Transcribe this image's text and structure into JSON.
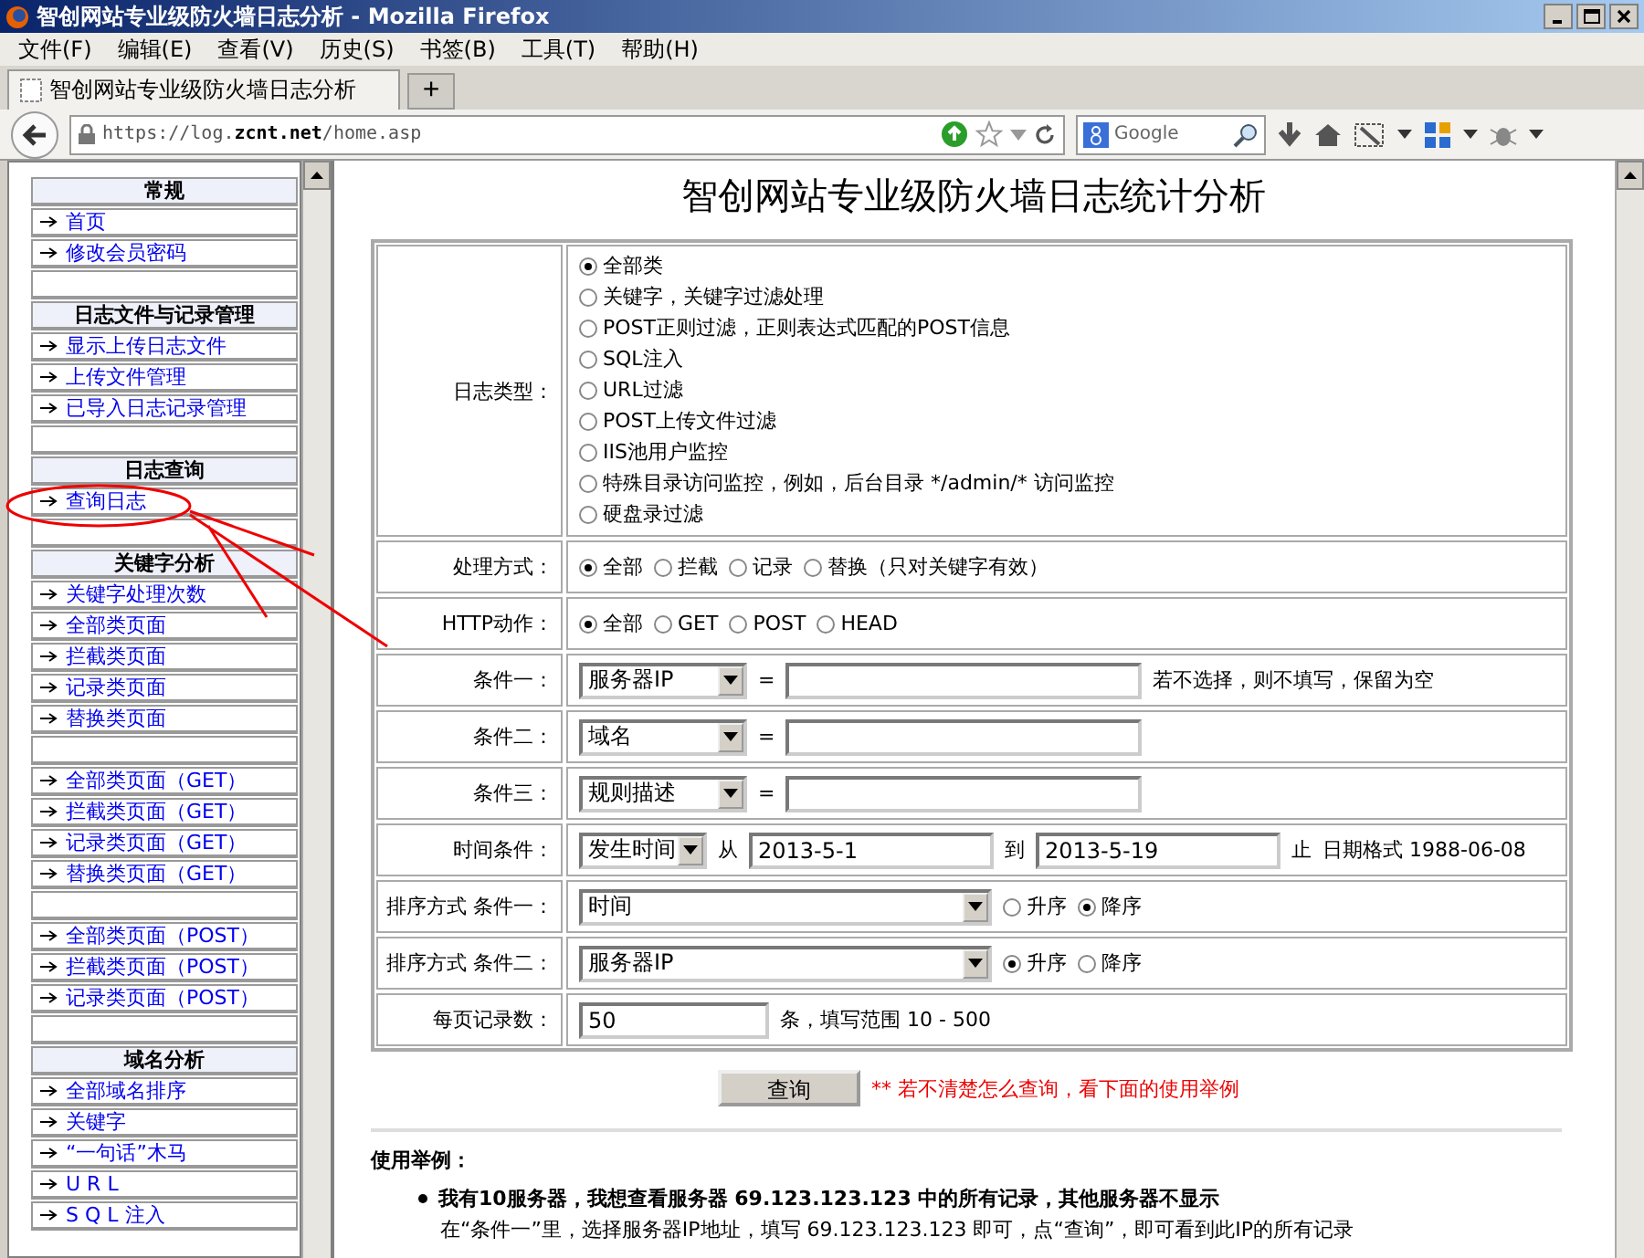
{
  "window": {
    "title": "智创网站专业级防火墙日志分析 - Mozilla Firefox"
  },
  "menu": [
    "文件(F)",
    "编辑(E)",
    "查看(V)",
    "历史(S)",
    "书签(B)",
    "工具(T)",
    "帮助(H)"
  ],
  "tabs": [
    {
      "label": "智创网站专业级防火墙日志分析",
      "selected": true
    }
  ],
  "tab_add": "+",
  "address": {
    "url": "https://log.**zcnt.net**/home.asp"
  },
  "search": {
    "placeholder": "Google"
  },
  "sidebar": [
    {
      "title": "常规",
      "groups": [
        [
          {
            "label": "首页"
          },
          {
            "label": "修改会员密码"
          }
        ]
      ]
    },
    {
      "title": "日志文件与记录管理",
      "groups": [
        [
          {
            "label": "显示上传日志文件"
          },
          {
            "label": "上传文件管理"
          },
          {
            "label": "已导入日志记录管理"
          }
        ]
      ]
    },
    {
      "title": "日志查询",
      "groups": [
        [
          {
            "label": "查询日志"
          }
        ]
      ]
    },
    {
      "title": "关键字分析",
      "groups": [
        [
          {
            "label": "关键字处理次数"
          },
          {
            "label": "全部类页面"
          },
          {
            "label": "拦截类页面"
          },
          {
            "label": "记录类页面"
          },
          {
            "label": "替换类页面"
          }
        ],
        [
          {
            "label": "全部类页面（GET）"
          },
          {
            "label": "拦截类页面（GET）"
          },
          {
            "label": "记录类页面（GET）"
          },
          {
            "label": "替换类页面（GET）"
          }
        ],
        [
          {
            "label": "全部类页面（POST）"
          },
          {
            "label": "拦截类页面（POST）"
          },
          {
            "label": "记录类页面（POST）"
          }
        ]
      ]
    },
    {
      "title": "域名分析",
      "groups": [
        [
          {
            "label": "全部域名排序"
          },
          {
            "label": "关键字"
          },
          {
            "label": "“一句话”木马"
          },
          {
            "label": "U R L"
          },
          {
            "label": "S Q L 注入"
          }
        ]
      ]
    }
  ],
  "page": {
    "title": "智创网站专业级防火墙日志统计分析",
    "form": [
      {
        "kind": "radio_list",
        "label": "日志类型：",
        "options": [
          {
            "label": "全部类",
            "selected": true
          },
          {
            "label": "关键字，关键字过滤处理",
            "selected": false
          },
          {
            "label": "POST正则过滤，正则表达式匹配的POST信息",
            "selected": false
          },
          {
            "label": "SQL注入",
            "selected": false
          },
          {
            "label": "URL过滤",
            "selected": false
          },
          {
            "label": "POST上传文件过滤",
            "selected": false
          },
          {
            "label": "IIS池用户监控",
            "selected": false
          },
          {
            "label": "特殊目录访问监控，例如，后台目录 */admin/* 访问监控",
            "selected": false
          },
          {
            "label": "硬盘录过滤",
            "selected": false
          }
        ]
      },
      {
        "kind": "radio_inline",
        "label": "处理方式：",
        "options": [
          {
            "label": "全部",
            "selected": true
          },
          {
            "label": "拦截",
            "selected": false
          },
          {
            "label": "记录",
            "selected": false
          },
          {
            "label": "替换（只对关键字有效）",
            "selected": false
          }
        ]
      },
      {
        "kind": "radio_inline",
        "label": "HTTP动作：",
        "options": [
          {
            "label": "全部",
            "selected": true
          },
          {
            "label": "GET",
            "selected": false
          },
          {
            "label": "POST",
            "selected": false
          },
          {
            "label": "HEAD",
            "selected": false
          }
        ]
      },
      {
        "kind": "condition",
        "label": "条件一：",
        "select": "服务器IP",
        "equals": "=",
        "note": "若不选择，则不填写，保留为空"
      },
      {
        "kind": "condition",
        "label": "条件二：",
        "select": "域名",
        "equals": "="
      },
      {
        "kind": "condition",
        "label": "条件三：",
        "select": "规则描述",
        "equals": "="
      },
      {
        "kind": "time",
        "label": "时间条件：",
        "select": "发生时间",
        "from": "从",
        "start": "2013-5-1",
        "to": "到",
        "end": "2013-5-19",
        "stop": "止",
        "note": "日期格式 1988-06-08"
      },
      {
        "kind": "sort",
        "label": "排序方式 条件一：",
        "select": "时间",
        "options": [
          {
            "label": "升序",
            "selected": false
          },
          {
            "label": "降序",
            "selected": true
          }
        ]
      },
      {
        "kind": "sort",
        "label": "排序方式 条件二：",
        "select": "服务器IP",
        "options": [
          {
            "label": "升序",
            "selected": true
          },
          {
            "label": "降序",
            "selected": false
          }
        ]
      },
      {
        "kind": "number",
        "label": "每页记录数：",
        "value": "50",
        "note": "条，填写范围 10 - 500"
      }
    ],
    "submit": "查询",
    "hint": "** 若不清楚怎么查询，看下面的使用举例",
    "usage": {
      "heading": "使用举例：",
      "items": [
        {
          "title": "我有10服务器，我想查看服务器 69.123.123.123 中的所有记录，其他服务器不显示",
          "text": "在“条件一”里，选择服务器IP地址，填写 69.123.123.123 即可，点“查询”，即可看到此IP的所有记录"
        }
      ]
    }
  }
}
